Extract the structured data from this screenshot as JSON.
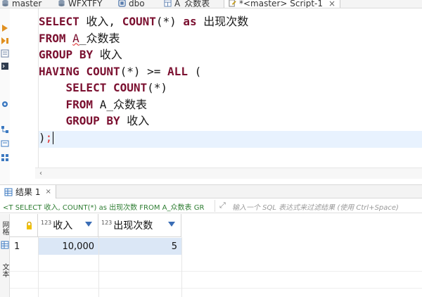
{
  "tabs": [
    {
      "label": "master",
      "icon": "database-icon"
    },
    {
      "label": "WFXTFY",
      "icon": "database-icon"
    },
    {
      "label": "dbo",
      "icon": "schema-icon"
    },
    {
      "label": "A_众数表",
      "icon": "table-icon"
    },
    {
      "label": "*<master> Script-1",
      "icon": "script-icon",
      "close": "×"
    }
  ],
  "editor": {
    "lines": [
      [
        "SELECT",
        " 收入, ",
        "COUNT",
        "(*) ",
        "as",
        " 出现次数"
      ],
      [
        "FROM",
        " ",
        "A",
        "_众数表"
      ],
      [
        "GROUP",
        " ",
        "BY",
        " 收入"
      ],
      [
        "HAVING",
        " ",
        "COUNT",
        "(*) >= ",
        "ALL",
        " ("
      ],
      [
        "    ",
        "SELECT",
        " ",
        "COUNT",
        "(*)"
      ],
      [
        "    ",
        "FROM",
        " A_众数表"
      ],
      [
        "    ",
        "GROUP",
        " ",
        "BY",
        " 收入"
      ],
      [
        ")",
        ";"
      ]
    ]
  },
  "results": {
    "tab_label": "结果 1",
    "tab_close": "×",
    "sql_prefix": "<T",
    "sql_preview": "SELECT 收入, COUNT(*) as 出现次数 FROM A_众数表 GR",
    "filter_placeholder": "输入一个 SQL 表达式来过滤结果 (使用 Ctrl+Space)",
    "side_tabs": [
      "网格",
      "文本"
    ],
    "columns": [
      {
        "type_badge": "123",
        "name": "收入"
      },
      {
        "type_badge": "123",
        "name": "出现次数"
      }
    ],
    "rows": [
      {
        "num": "1",
        "cells": [
          "10,000",
          "5"
        ]
      }
    ]
  },
  "colors": {
    "keyword": "#7b1030",
    "selection": "#dbe7f6",
    "current_line": "#e8f2fe",
    "sql_preview": "#2e7d32"
  }
}
